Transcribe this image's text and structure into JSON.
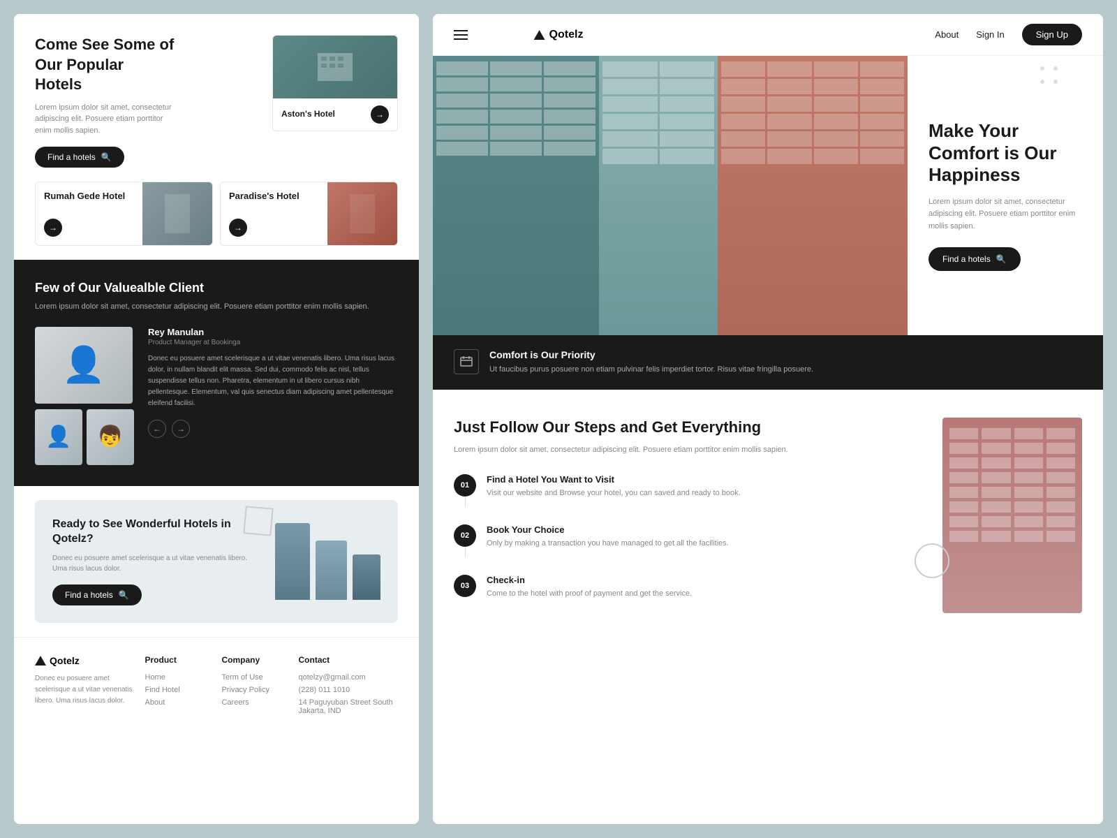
{
  "brand": {
    "name": "Qotelz",
    "tagline": "Donec eu posuere amet scelerisque a ut vitae venenatis libero. Uma risus lacus dolor."
  },
  "left": {
    "hero": {
      "title": "Come See Some of Our Popular Hotels",
      "description": "Lorem ipsum dolor sit amet, consectetur adipiscing elit. Posuere etiam porttitor enim mollis sapien.",
      "find_btn": "Find a hotels"
    },
    "hotels": [
      {
        "name": "Aston's Hotel",
        "type": "teal"
      },
      {
        "name": "Rumah Gede Hotel",
        "type": "gray"
      },
      {
        "name": "Paradise's Hotel",
        "type": "red"
      }
    ],
    "clients": {
      "title": "Few of Our Valuealble Client",
      "description": "Lorem ipsum dolor sit amet, consectetur adipiscing elit. Posuere etiam porttitor enim mollis sapien.",
      "client_name": "Rey Manulan",
      "client_role": "Product Manager at Bookinga",
      "client_testimonial": "Donec eu posuere amet scelerisque a ut vitae venenatis libero. Uma risus lacus dolor, in nullam blandit elit massa. Sed dui, commodo felis ac nisl, tellus suspendisse tellus non. Pharetra, elementum in ut libero cursus nibh pellentesque. Elementum, val quis senectus diam adipiscing amet pellentesque eleifend facilisi."
    },
    "cta": {
      "title": "Ready to See Wonderful Hotels in Qotelz?",
      "description": "Donec eu posuere amet scelerisque a ut vitae venenatis libero. Uma risus lacus dolor.",
      "btn_label": "Find a hotels"
    },
    "footer": {
      "product_title": "Product",
      "product_links": [
        "Home",
        "Find Hotel",
        "About"
      ],
      "company_title": "Company",
      "company_links": [
        "Term of Use",
        "Privacy Policy",
        "Careers"
      ],
      "contact_title": "Contact",
      "contact_email": "qotelzy@gmail.com",
      "contact_phone": "(228) 011 1010",
      "contact_address": "14 Paguyuban Street South Jakarta, IND"
    }
  },
  "right": {
    "nav": {
      "about": "About",
      "signin": "Sign In",
      "signup": "Sign Up"
    },
    "hero": {
      "title": "Make Your Comfort is Our Happiness",
      "description": "Lorem ipsum dolor sit amet, consectetur adipiscing elit. Posuere etiam porttitor enim mollis sapien.",
      "find_btn": "Find a hotels"
    },
    "comfort": {
      "title": "Comfort is Our Priority",
      "description": "Ut faucibus purus posuere non etiam pulvinar felis imperdiet tortor. Risus vitae fringilla posuere."
    },
    "steps": {
      "title": "Just Follow Our Steps and Get Everything",
      "description": "Lorem ipsum dolor sit amet, consectetur adipiscing elit. Posuere etiam porttitor enim mollis sapien.",
      "items": [
        {
          "number": "01",
          "title": "Find a Hotel You Want to Visit",
          "description": "Visit our website and Browse your hotel, you can saved and ready to book."
        },
        {
          "number": "02",
          "title": "Book Your Choice",
          "description": "Only by making a transaction you have managed to get all the facilities."
        },
        {
          "number": "03",
          "title": "Check-in",
          "description": "Come to the hotel with proof of payment and get the service."
        }
      ]
    }
  }
}
